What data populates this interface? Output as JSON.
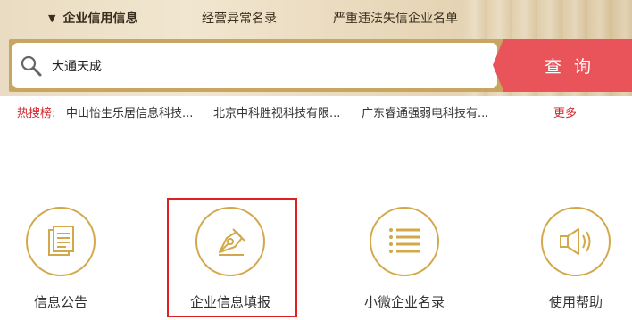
{
  "tabs": [
    {
      "label": "企业信用信息",
      "active": true
    },
    {
      "label": "经营异常名录",
      "active": false
    },
    {
      "label": "严重违法失信企业名单",
      "active": false
    }
  ],
  "search": {
    "value": "大通天成",
    "button_label": "查询",
    "search_icon": "search-icon"
  },
  "hot_search": {
    "label": "热搜榜:",
    "items": [
      "中山怡生乐居信息科技...",
      "北京中科胜视科技有限...",
      "广东睿通强弱电科技有..."
    ],
    "more_label": "更多"
  },
  "services": [
    {
      "label": "信息公告",
      "icon": "document-icon"
    },
    {
      "label": "企业信息填报",
      "icon": "pen-icon",
      "highlighted": true
    },
    {
      "label": "小微企业名录",
      "icon": "list-icon"
    },
    {
      "label": "使用帮助",
      "icon": "speaker-icon"
    }
  ],
  "colors": {
    "accent_gold": "#d3a84a",
    "search_button": "#e8545a",
    "hot_red": "#d0262b",
    "highlight_border": "#e02020"
  }
}
